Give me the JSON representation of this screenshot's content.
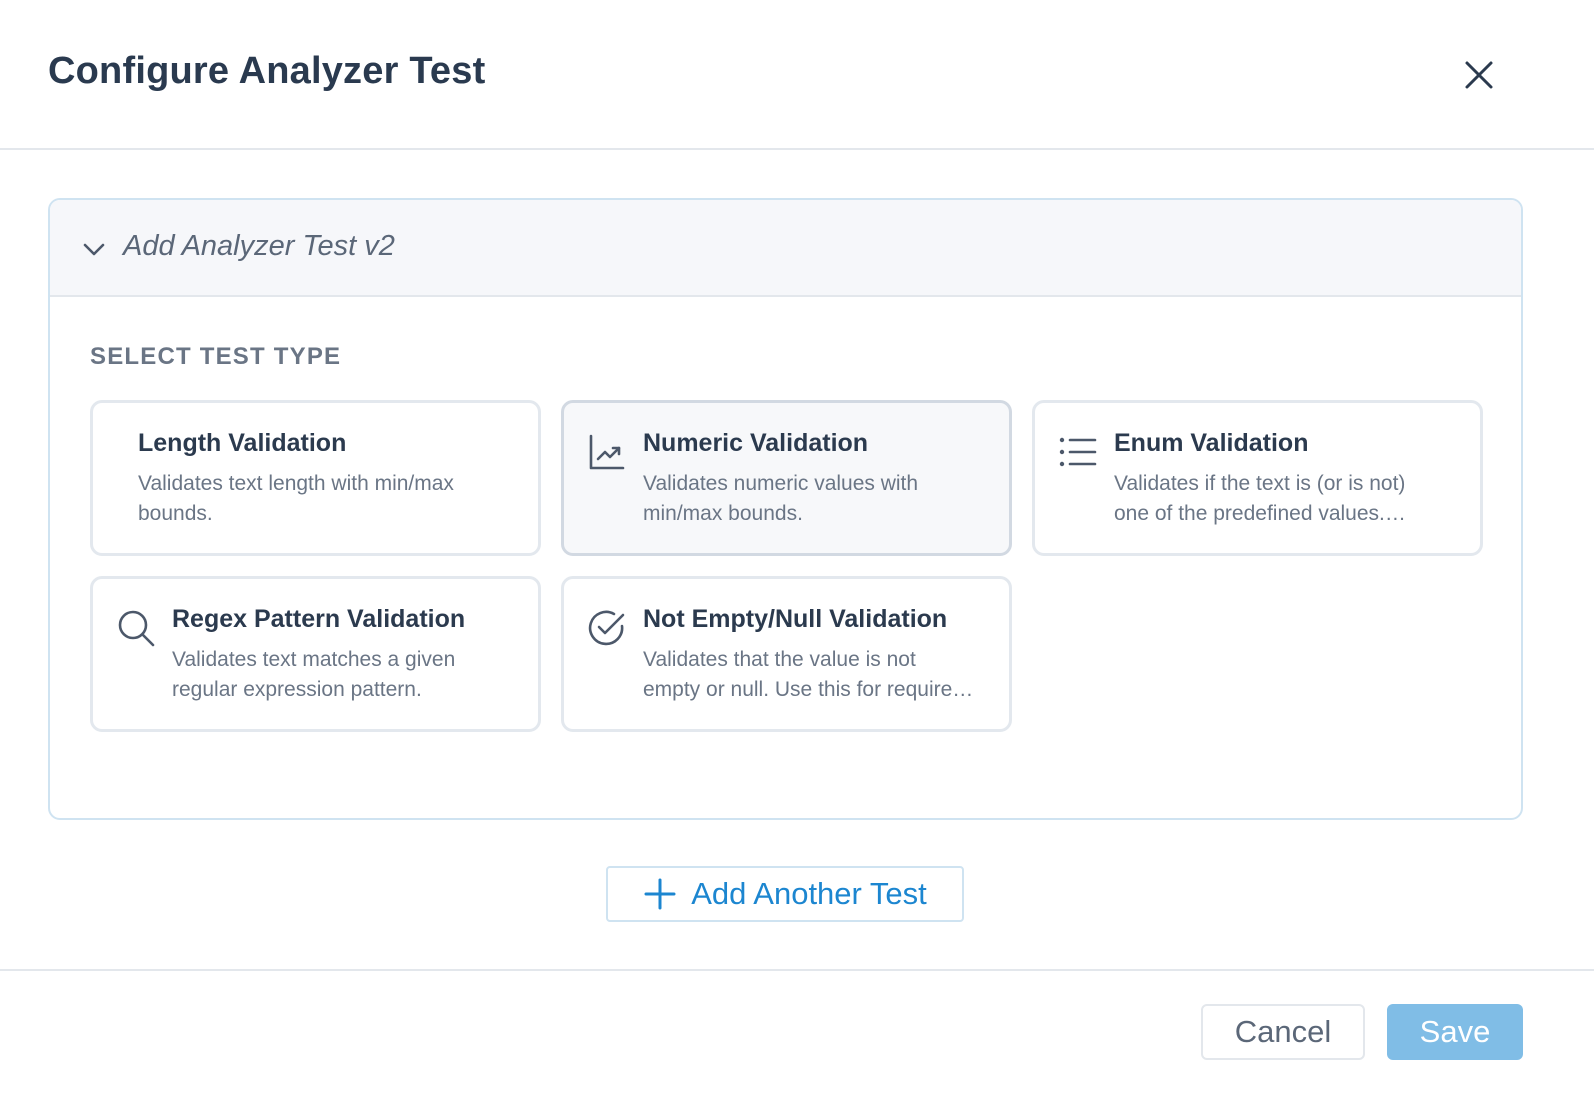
{
  "modal": {
    "title": "Configure Analyzer Test",
    "close_icon": "close-icon"
  },
  "panel": {
    "title": "Add Analyzer Test v2",
    "chevron_icon": "chevron-down-icon",
    "section_label": "SELECT TEST TYPE"
  },
  "test_types": [
    {
      "title": "Length Validation",
      "description": "Validates text length with min/max bounds.",
      "icon": "",
      "selected": false
    },
    {
      "title": "Numeric Validation",
      "description": "Validates numeric values with min/max bounds.",
      "icon": "chart-line-icon",
      "selected": true
    },
    {
      "title": "Enum Validation",
      "description_line1": "Validates if the text is (or is not)",
      "description_line2": "one of the predefined values.…",
      "icon": "list-icon",
      "selected": false
    },
    {
      "title": "Regex Pattern Validation",
      "description": "Validates text matches a given regular expression pattern.",
      "icon": "search-icon",
      "selected": false
    },
    {
      "title": "Not Empty/Null Validation",
      "description_line1": "Validates that the value is not",
      "description_line2": "empty or null. Use this for require…",
      "icon": "check-circle-icon",
      "selected": false
    }
  ],
  "actions": {
    "add_another": "Add Another Test",
    "add_icon": "plus-icon",
    "cancel": "Cancel",
    "save": "Save"
  },
  "colors": {
    "accent": "#1c86d0",
    "save_disabled": "#80bde6",
    "panel_border": "#cfe3f1",
    "text_primary": "#2b3a4e",
    "text_muted": "#6a7585"
  }
}
